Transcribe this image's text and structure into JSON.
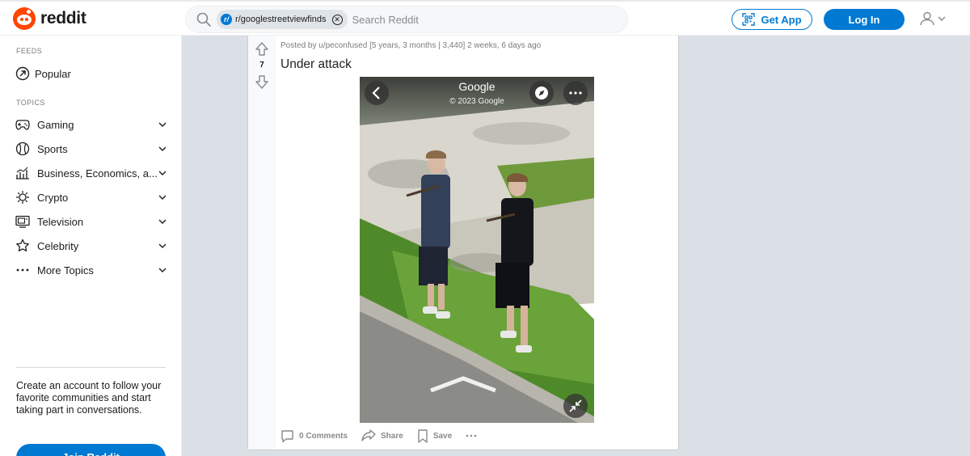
{
  "header": {
    "logo_text": "reddit",
    "search": {
      "chip_label": "r/googlestreetviewfinds",
      "chip_icon_text": "r/",
      "placeholder": "Search Reddit"
    },
    "get_app_label": "Get App",
    "login_label": "Log In"
  },
  "sidebar": {
    "feeds_heading": "FEEDS",
    "popular_label": "Popular",
    "topics_heading": "TOPICS",
    "topics": [
      {
        "label": "Gaming",
        "icon": "gamepad-icon"
      },
      {
        "label": "Sports",
        "icon": "ball-icon"
      },
      {
        "label": "Business, Economics, a...",
        "icon": "bar-chart-icon"
      },
      {
        "label": "Crypto",
        "icon": "crypto-icon"
      },
      {
        "label": "Television",
        "icon": "tv-icon"
      },
      {
        "label": "Celebrity",
        "icon": "star-icon"
      },
      {
        "label": "More Topics",
        "icon": "more-dots-icon"
      }
    ],
    "cta_text": "Create an account to follow your favorite communities and start taking part in conversations.",
    "join_label": "Join Reddit"
  },
  "post": {
    "vote_count": "7",
    "meta": "Posted by u/peconfused   [5 years, 3 months | 3,440]  2 weeks, 6 days ago",
    "title": "Under attack",
    "image": {
      "brand": "Google",
      "copyright": "© 2023 Google"
    },
    "actions": {
      "comments": "0 Comments",
      "share": "Share",
      "save": "Save"
    }
  },
  "colors": {
    "brand": "#ff4500",
    "accent": "#0079d3",
    "background": "#dae0e6"
  }
}
